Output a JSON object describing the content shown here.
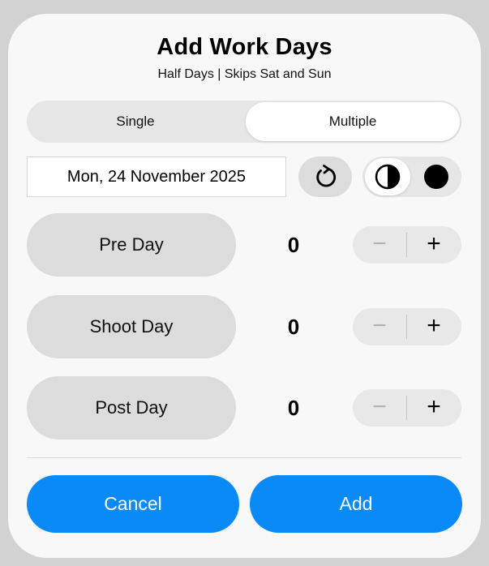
{
  "dialog": {
    "title": "Add Work Days",
    "subtitle": "Half Days | Skips Sat and Sun"
  },
  "mode_segment": {
    "options": [
      "Single",
      "Multiple"
    ],
    "selected": "Multiple"
  },
  "date_field": {
    "value": "Mon, 24 November 2025"
  },
  "reset_button": {
    "icon": "reset-icon"
  },
  "day_mode_toggle": {
    "options": [
      {
        "icon": "half-circle-icon",
        "label": "Half Day"
      },
      {
        "icon": "full-circle-icon",
        "label": "Full Day"
      }
    ],
    "selected": "half-circle-icon"
  },
  "rows": [
    {
      "label": "Pre Day",
      "count": "0",
      "minus": "−",
      "plus": "+"
    },
    {
      "label": "Shoot Day",
      "count": "0",
      "minus": "−",
      "plus": "+"
    },
    {
      "label": "Post Day",
      "count": "0",
      "minus": "−",
      "plus": "+"
    }
  ],
  "actions": {
    "cancel_label": "Cancel",
    "add_label": "Add"
  },
  "colors": {
    "accent": "#0a8af6",
    "background": "#f8f8f8",
    "pill": "#dcdcdc"
  }
}
